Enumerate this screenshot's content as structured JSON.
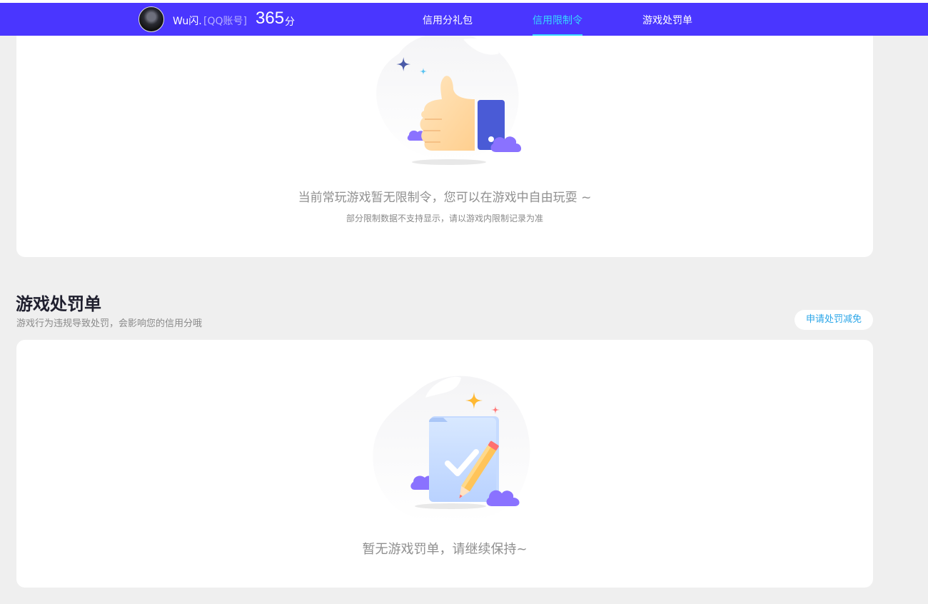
{
  "header": {
    "user_name": "Wu闪.",
    "account_type": "[QQ账号]",
    "score": "365",
    "score_unit": "分",
    "tabs": [
      {
        "label": "信用分礼包",
        "active": false
      },
      {
        "label": "信用限制令",
        "active": true
      },
      {
        "label": "游戏处罚单",
        "active": false
      }
    ],
    "colors": {
      "bar": "#4a36ff",
      "active_tab": "#36d8ff"
    }
  },
  "restriction_card": {
    "empty_text": "当前常玩游戏暂无限制令，您可以在游戏中自由玩耍 ~",
    "note": "部分限制数据不支持显示，请以游戏内限制记录为准",
    "illustration": "thumbs-up-icon"
  },
  "penalty_section": {
    "title": "游戏处罚单",
    "description": "游戏行为违规导致处罚，会影响您的信用分哦",
    "apply_button": "申请处罚减免",
    "empty_text": "暂无游戏罚单，请继续保持~",
    "illustration": "clipboard-check-icon"
  }
}
